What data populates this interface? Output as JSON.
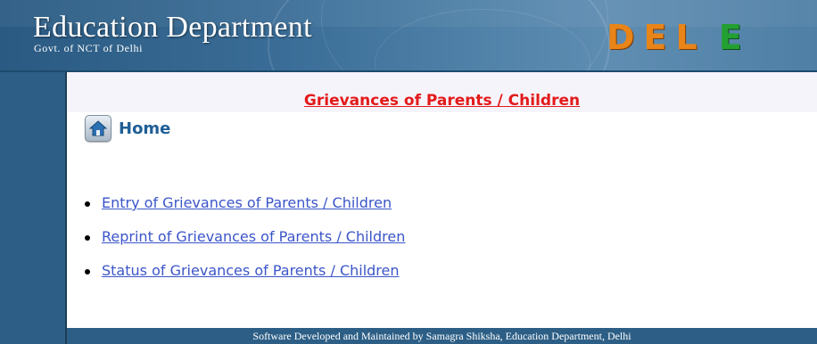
{
  "header": {
    "title": "Education Department",
    "subtitle": "Govt. of NCT of Delhi",
    "logo_text_1": "DEL",
    "logo_text_2": "E"
  },
  "page": {
    "heading": "Grievances of Parents / Children",
    "home_label": "Home"
  },
  "menu": {
    "items": [
      {
        "label": "Entry of Grievances of Parents / Children"
      },
      {
        "label": "Reprint of Grievances of Parents / Children"
      },
      {
        "label": "Status of Grievances of Parents / Children"
      }
    ]
  },
  "footer": {
    "text": "Software Developed and Maintained by Samagra Shiksha, Education Department, Delhi"
  },
  "icons": {
    "home": "home-icon"
  },
  "colors": {
    "header_blue": "#3a6d97",
    "sidebar_blue": "#2d5f86",
    "heading_red": "#e31a1a",
    "link_blue": "#3b55c9",
    "home_blue": "#1f5f96",
    "logo_orange": "#e88418",
    "logo_green": "#23a032"
  }
}
